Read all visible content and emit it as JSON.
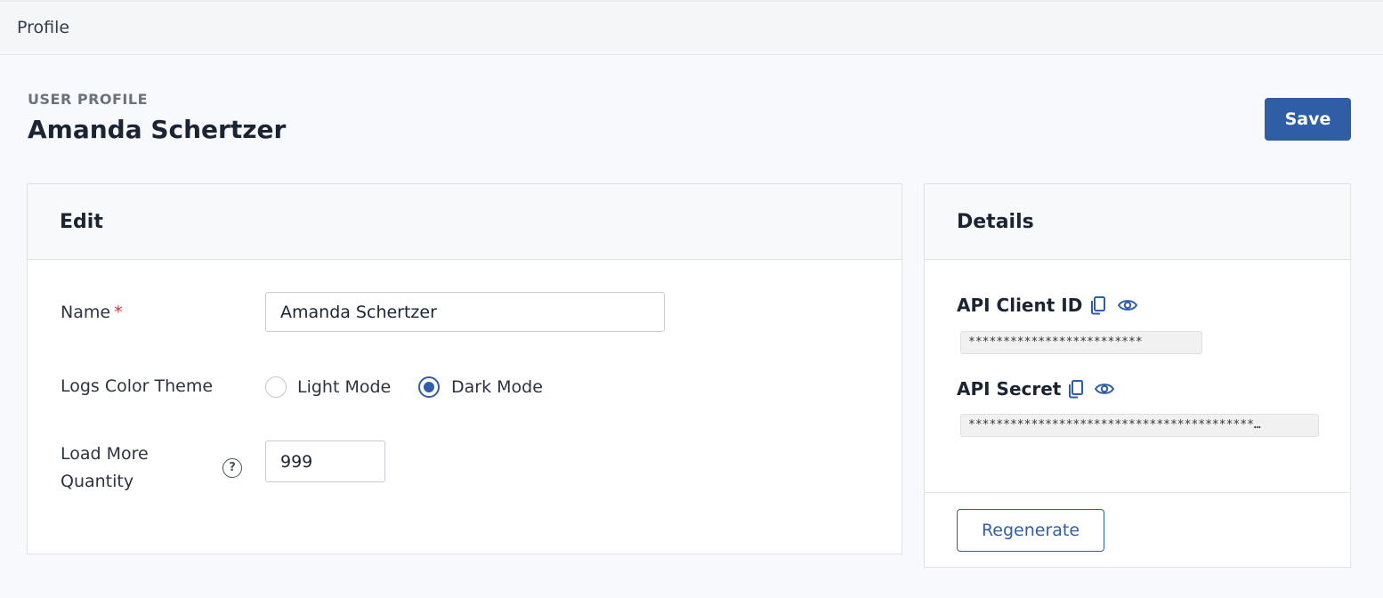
{
  "topbar": {
    "breadcrumb": "Profile"
  },
  "header": {
    "eyebrow": "USER PROFILE",
    "title": "Amanda Schertzer",
    "save_label": "Save"
  },
  "edit": {
    "title": "Edit",
    "name_label": "Name",
    "required_mark": "*",
    "name_value": "Amanda Schertzer",
    "theme_label": "Logs Color Theme",
    "theme_options": [
      {
        "label": "Light Mode",
        "selected": false
      },
      {
        "label": "Dark Mode",
        "selected": true
      }
    ],
    "load_more_label_line1": "Load More",
    "load_more_label_line2": "Quantity",
    "load_more_value": "999",
    "help_glyph": "?"
  },
  "details": {
    "title": "Details",
    "client_id_label": "API Client ID",
    "client_id_masked": "*************************",
    "secret_label": "API Secret",
    "secret_masked": "*****************************************…",
    "regenerate_label": "Regenerate"
  },
  "colors": {
    "primary": "#2f5ea6",
    "required": "#c9343f"
  },
  "icons": {
    "copy": "copy-icon",
    "view": "eye-icon",
    "help": "question-circle-icon"
  }
}
